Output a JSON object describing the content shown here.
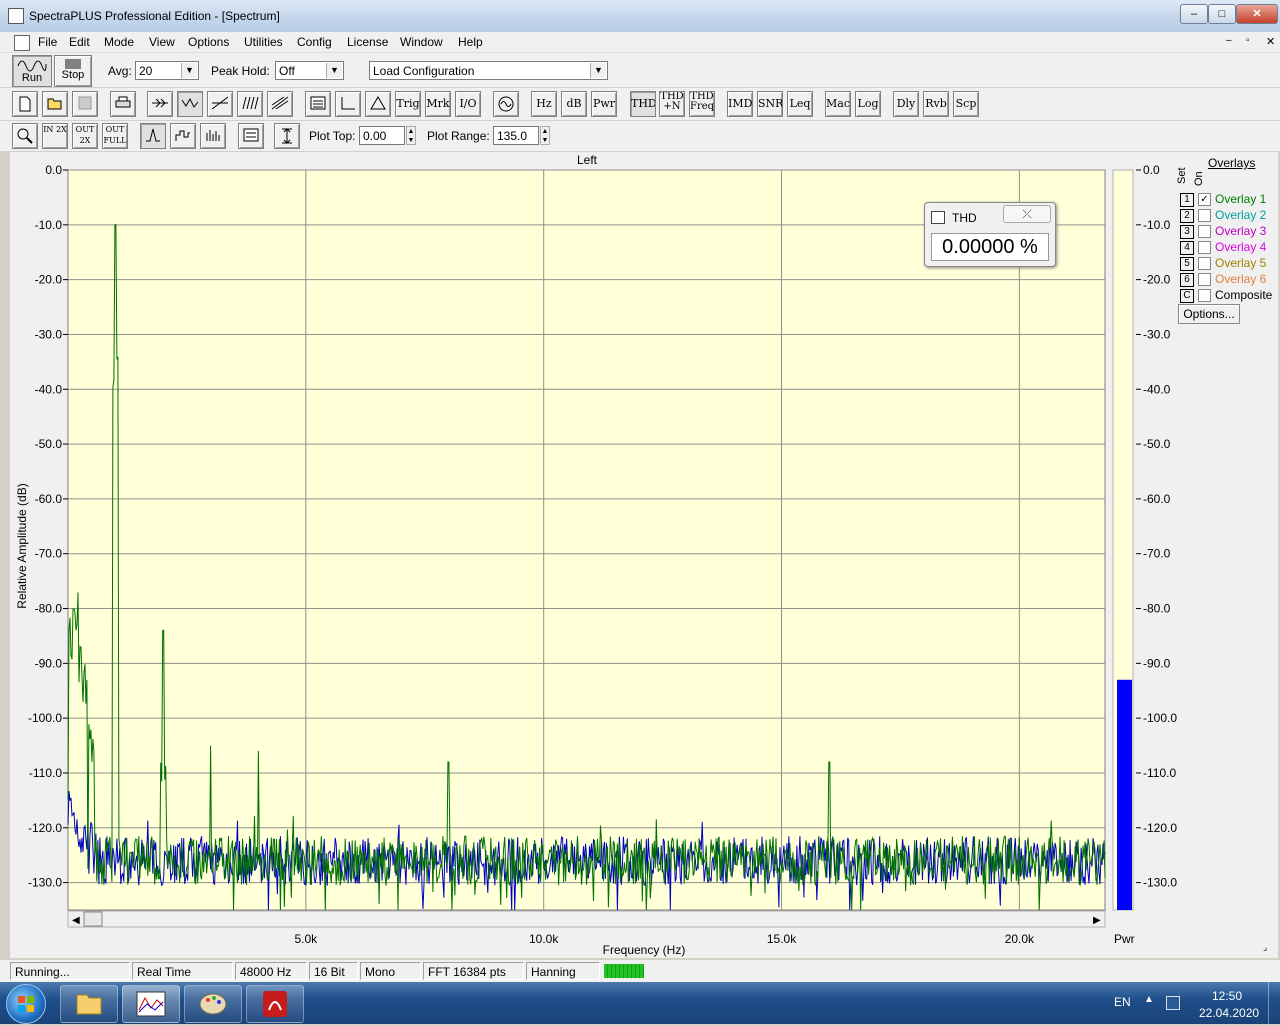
{
  "window": {
    "title": "SpectraPLUS Professional Edition - [Spectrum]",
    "min": "–",
    "max": "□",
    "close": "✕"
  },
  "menu": [
    "File",
    "Edit",
    "Mode",
    "View",
    "Options",
    "Utilities",
    "Config",
    "License",
    "Window",
    "Help"
  ],
  "toolbar1": {
    "run": "Run",
    "stop": "Stop",
    "avg_label": "Avg:",
    "avg_value": "20",
    "peak_label": "Peak Hold:",
    "peak_value": "Off",
    "config_value": "Load Configuration"
  },
  "toolbar2": {
    "buttons": [
      "Trig",
      "Mrk",
      "I/O",
      "Hz",
      "dB",
      "Pwr",
      "THD",
      "THD +N",
      "THD Freq",
      "IMD",
      "SNR",
      "Leq",
      "Mac",
      "Log",
      "Dly",
      "Rvb",
      "Scp"
    ]
  },
  "toolbar3": {
    "zoom_in_2x": "IN 2X",
    "zoom_out_2x": "OUT 2X",
    "zoom_out_full": "OUT FULL",
    "plot_top_label": "Plot Top:",
    "plot_top_value": "0.00",
    "plot_range_label": "Plot Range:",
    "plot_range_value": "135.0"
  },
  "chart_data": {
    "type": "line",
    "title": "Left",
    "xlabel": "Frequency (Hz)",
    "ylabel": "Relative Amplitude (dB)",
    "xlim": [
      0,
      21800
    ],
    "ylim": [
      -135,
      0
    ],
    "x_ticks": [
      {
        "v": 5000,
        "label": "5.0k"
      },
      {
        "v": 10000,
        "label": "10.0k"
      },
      {
        "v": 15000,
        "label": "15.0k"
      },
      {
        "v": 20000,
        "label": "20.0k"
      }
    ],
    "y_ticks": [
      {
        "v": 0,
        "label": "0.0"
      },
      {
        "v": -10,
        "label": "-10.0"
      },
      {
        "v": -20,
        "label": "-20.0"
      },
      {
        "v": -30,
        "label": "-30.0"
      },
      {
        "v": -40,
        "label": "-40.0"
      },
      {
        "v": -50,
        "label": "-50.0"
      },
      {
        "v": -60,
        "label": "-60.0"
      },
      {
        "v": -70,
        "label": "-70.0"
      },
      {
        "v": -80,
        "label": "-80.0"
      },
      {
        "v": -90,
        "label": "-90.0"
      },
      {
        "v": -100,
        "label": "-100.0"
      },
      {
        "v": -110,
        "label": "-110.0"
      },
      {
        "v": -120,
        "label": "-120.0"
      },
      {
        "v": -130,
        "label": "-130.0"
      }
    ],
    "grid": true,
    "series": [
      {
        "color": "#007000",
        "noise_floor": -126,
        "peaks": [
          {
            "x": 1000,
            "y": -10
          },
          {
            "x": 2000,
            "y": -84
          },
          {
            "x": 3000,
            "y": -105
          },
          {
            "x": 4000,
            "y": -106
          },
          {
            "x": 8000,
            "y": -108
          },
          {
            "x": 16000,
            "y": -108
          }
        ],
        "low_freq": [
          {
            "x": 80,
            "y": -90
          },
          {
            "x": 150,
            "y": -84
          },
          {
            "x": 250,
            "y": -95
          },
          {
            "x": 350,
            "y": -100
          },
          {
            "x": 500,
            "y": -108
          }
        ]
      },
      {
        "color": "#0000c0",
        "noise_floor": -126,
        "peaks": [],
        "low_freq": []
      }
    ],
    "power_bar": {
      "label": "Pwr",
      "value": -93,
      "color": "#0000ff"
    }
  },
  "thd_box": {
    "title": "THD",
    "value": "0.00000 %"
  },
  "overlays": {
    "header": "Overlays",
    "set_label": "Set",
    "on_label": "On",
    "items": [
      {
        "set": "1",
        "label": "Overlay 1",
        "checked": true,
        "color": "#008000"
      },
      {
        "set": "2",
        "label": "Overlay 2",
        "checked": false,
        "color": "#00a0a0"
      },
      {
        "set": "3",
        "label": "Overlay 3",
        "checked": false,
        "color": "#c000c0"
      },
      {
        "set": "4",
        "label": "Overlay 4",
        "checked": false,
        "color": "#e000e0"
      },
      {
        "set": "5",
        "label": "Overlay 5",
        "checked": false,
        "color": "#a08000"
      },
      {
        "set": "6",
        "label": "Overlay 6",
        "checked": false,
        "color": "#e08040"
      },
      {
        "set": "C",
        "label": "Composite",
        "checked": false,
        "color": "#000000"
      }
    ],
    "options_button": "Options..."
  },
  "status": [
    "Running...",
    "Real Time",
    "48000 Hz",
    "16 Bit",
    "Mono",
    "FFT 16384 pts",
    "Hanning"
  ],
  "taskbar": {
    "lang": "EN",
    "time": "12:50",
    "date": "22.04.2020"
  }
}
